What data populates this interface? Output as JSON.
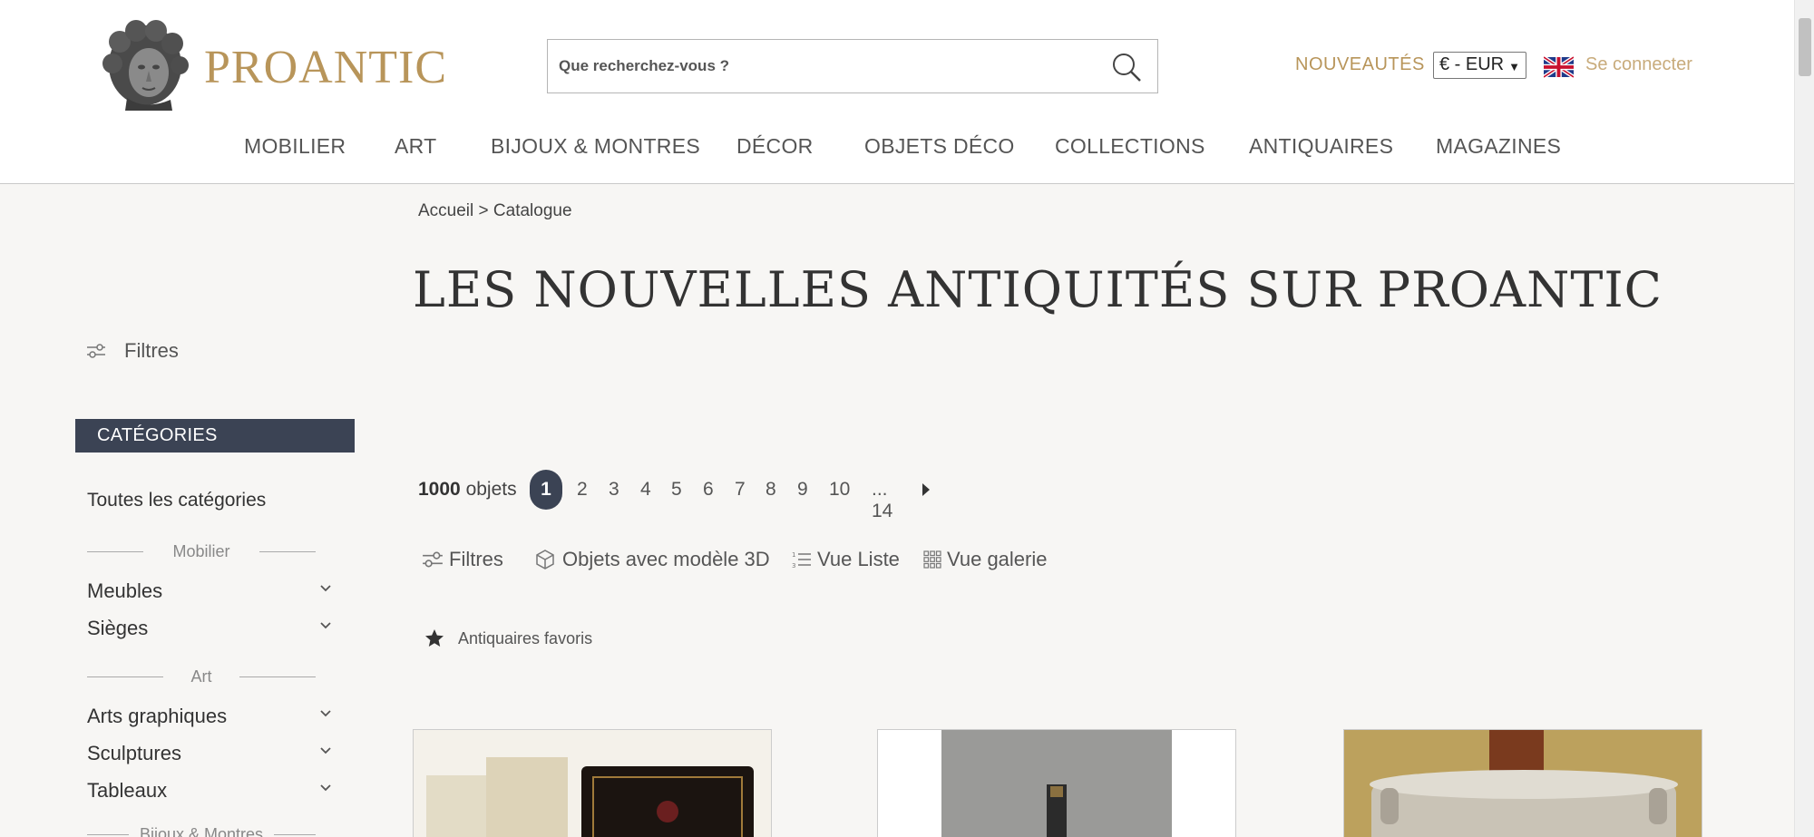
{
  "brand": {
    "name": "PROANTIC"
  },
  "search": {
    "placeholder": "Que recherchez-vous ?"
  },
  "header": {
    "new_label": "NOUVEAUTÉS",
    "currency": "€ - EUR",
    "login_label": "Se connecter"
  },
  "nav": {
    "items": [
      {
        "label": "MOBILIER"
      },
      {
        "label": "ART"
      },
      {
        "label": "BIJOUX & MONTRES"
      },
      {
        "label": "DÉCOR"
      },
      {
        "label": "OBJETS DÉCO"
      },
      {
        "label": "COLLECTIONS"
      },
      {
        "label": "ANTIQUAIRES"
      },
      {
        "label": "MAGAZINES"
      }
    ]
  },
  "breadcrumb": {
    "home": "Accueil",
    "separator": ">",
    "current": "Catalogue"
  },
  "page_title": "LES NOUVELLES ANTIQUITÉS SUR PROANTIC",
  "sidebar": {
    "filters_label": "Filtres",
    "categories_header": "CATÉGORIES",
    "all_categories": "Toutes les catégories",
    "groups": [
      {
        "label": "Mobilier",
        "items": [
          "Meubles",
          "Sièges"
        ]
      },
      {
        "label": "Art",
        "items": [
          "Arts graphiques",
          "Sculptures",
          "Tableaux"
        ]
      },
      {
        "label": "Bijoux & Montres"
      }
    ]
  },
  "results": {
    "count": "1000",
    "count_suffix": "objets",
    "pages": [
      "1",
      "2",
      "3",
      "4",
      "5",
      "6",
      "7",
      "8",
      "9",
      "10",
      "... 14"
    ],
    "current_page": "1"
  },
  "toolbar": {
    "filters": "Filtres",
    "models_3d": "Objets avec modèle 3D",
    "list_view": "Vue Liste",
    "gallery_view": "Vue galerie",
    "favorites": "Antiquaires favoris"
  },
  "colors": {
    "brand_gold": "#b8955a",
    "dark_navy": "#3b4354",
    "background": "#f7f6f4"
  }
}
